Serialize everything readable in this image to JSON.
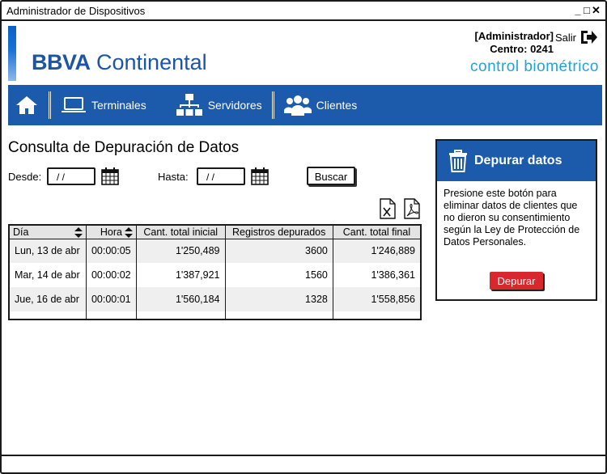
{
  "window": {
    "title": "Administrador de Dispositivos",
    "controls": [
      "_",
      "□",
      "✕"
    ]
  },
  "header": {
    "logo_bold": "BBVA",
    "logo_regular": "Continental",
    "user_role": "[Administrador]",
    "center": "Centro: 0241",
    "logout_label": "Salir",
    "subtitle": "control biométrico"
  },
  "nav": {
    "home_icon": "home-icon",
    "items": [
      {
        "label": "Terminales",
        "icon": "laptop-icon"
      },
      {
        "label": "Servidores",
        "icon": "sitemap-icon"
      },
      {
        "label": "Clientes",
        "icon": "users-icon"
      }
    ]
  },
  "main": {
    "title": "Consulta de Depuración de Datos",
    "desde_label": "Desde:",
    "hasta_label": "Hasta:",
    "desde_value": "/ /",
    "hasta_value": "/ /",
    "search_label": "Buscar",
    "export_icons": [
      "excel-icon",
      "pdf-icon"
    ]
  },
  "table": {
    "headers": [
      "Día",
      "Hora",
      "Cant. total inicial",
      "Registros depurados",
      "Cant. total final"
    ],
    "rows": [
      [
        "Lun, 13 de abr",
        "00:00:05",
        "1'250,489",
        "3600",
        "1'246,889"
      ],
      [
        "Mar, 14 de abr",
        "00:00:02",
        "1'387,921",
        "1560",
        "1'386,361"
      ],
      [
        "Jue, 16 de abr",
        "00:00:01",
        "1'560,184",
        "1328",
        "1'558,856"
      ]
    ]
  },
  "panel": {
    "title": "Depurar datos",
    "description": "Presione este botón para eliminar datos de clientes que no dieron su consentimiento según la Ley de Protección de Datos Personales.",
    "button_label": "Depurar"
  },
  "colors": {
    "brand": "#1c5aac",
    "accent": "#22a3d6",
    "danger": "#d9272e"
  }
}
